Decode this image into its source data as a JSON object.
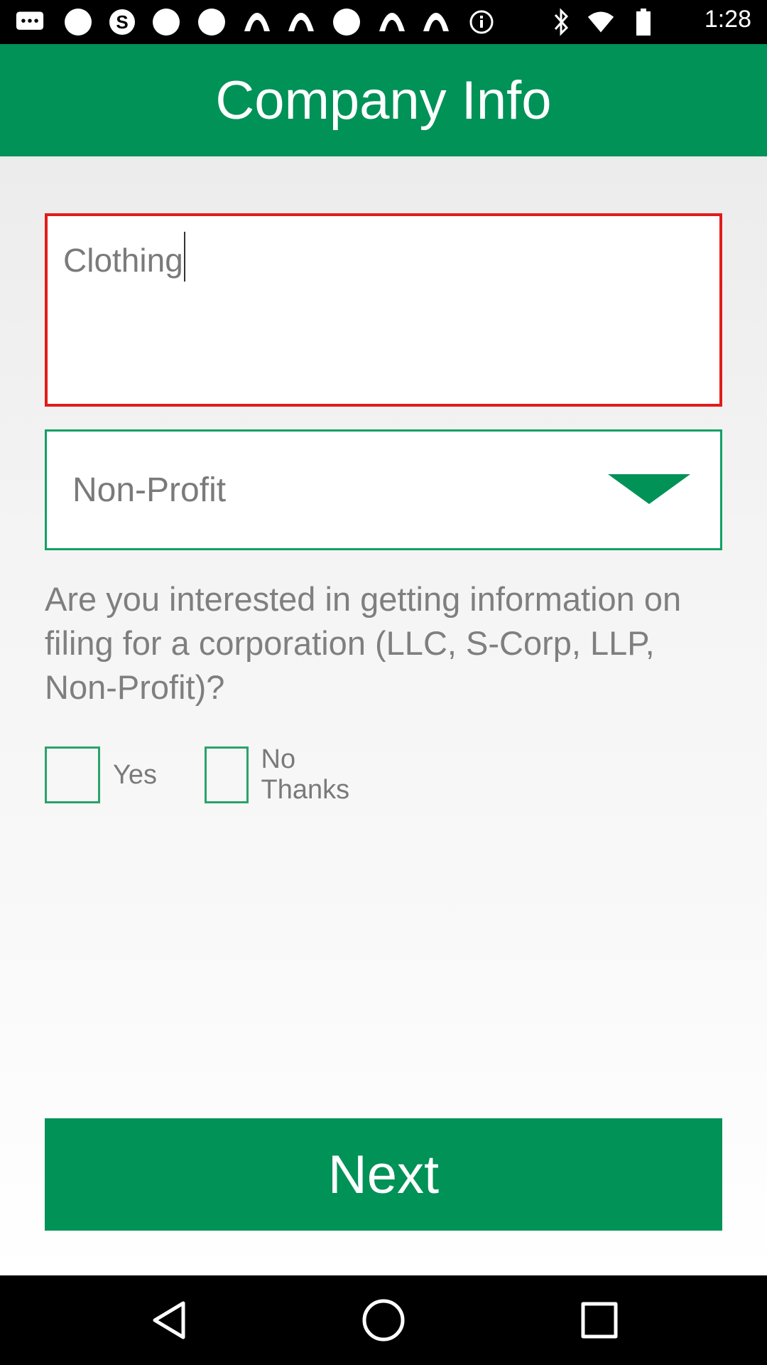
{
  "status_bar": {
    "time": "1:28",
    "icons": [
      "messaging-icon",
      "circle-icon",
      "skype-icon",
      "circle-icon",
      "circle-icon",
      "wave-icon",
      "wave-icon",
      "circle-icon",
      "wave-icon",
      "wave-icon",
      "info-icon",
      "bluetooth-icon",
      "wifi-icon",
      "battery-icon"
    ]
  },
  "header": {
    "title": "Company Info"
  },
  "form": {
    "industry_value": "Clothing",
    "type_selected": "Non-Profit",
    "question": "Are you interested in getting information on filing for a corporation (LLC, S-Corp, LLP, Non-Profit)?",
    "options": [
      {
        "label": "Yes",
        "checked": false
      },
      {
        "label": "No Thanks",
        "checked": false
      }
    ]
  },
  "actions": {
    "next_label": "Next"
  },
  "navigation": {
    "icons": [
      "back-icon",
      "home-icon",
      "recents-icon"
    ]
  },
  "colors": {
    "primary": "#009257",
    "error_border": "#e21b1b",
    "text_gray": "#7a7a7a"
  }
}
